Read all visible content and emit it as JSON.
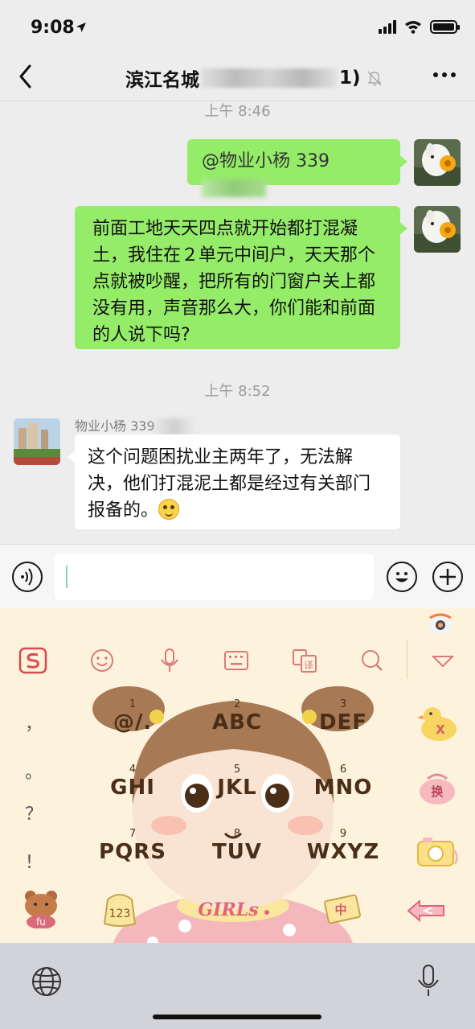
{
  "status": {
    "time": "9:08"
  },
  "nav": {
    "title_prefix": "滨江名城",
    "title_suffix": "1)"
  },
  "chat": {
    "timestamp1": "上午 8:46",
    "msg1_mention": "@物业小杨 ",
    "msg1_number": "339",
    "msg2_text": "前面工地天天四点就开始都打混凝土，我住在２单元中间户，天天那个点就被吵醒，把所有的门窗户关上都没有用，声音那么大，你们能和前面的人说下吗?",
    "timestamp2": "上午 8:52",
    "sender_name": "物业小杨 339",
    "msg3_text": "这个问题困扰业主两年了，无法解决，他们打混泥土都是经过有关部门报备的。"
  },
  "keyboard": {
    "keys": [
      {
        "num": "1",
        "label": "@/."
      },
      {
        "num": "2",
        "label": "ABC"
      },
      {
        "num": "3",
        "label": "DEF"
      },
      {
        "num": "4",
        "label": "GHI"
      },
      {
        "num": "5",
        "label": "JKL"
      },
      {
        "num": "6",
        "label": "MNO"
      },
      {
        "num": "7",
        "label": "PQRS"
      },
      {
        "num": "8",
        "label": "TUV"
      },
      {
        "num": "9",
        "label": "WXYZ"
      }
    ],
    "punctuation": [
      "，",
      "。",
      "？",
      "！"
    ],
    "sticker_text": {
      "x": "X",
      "huan": "换",
      "num": "123",
      "zhong": "中",
      "girls": "GIRLs",
      "fu": "fu"
    }
  },
  "colors": {
    "my_bubble": "#95ec69",
    "other_bubble": "#ffffff",
    "chat_bg": "#ededed",
    "keyboard_bg": "#fdf3dd",
    "keyboard_icon": "#d97a7a"
  },
  "icons": [
    "back-arrow-icon",
    "mute-bell-icon",
    "more-dots-icon",
    "voice-icon",
    "emoji-icon",
    "plus-icon",
    "sogou-logo-icon",
    "smiley-icon",
    "microphone-icon",
    "keyboard-icon",
    "translate-icon",
    "search-icon",
    "collapse-icon",
    "globe-icon",
    "dictation-icon"
  ]
}
